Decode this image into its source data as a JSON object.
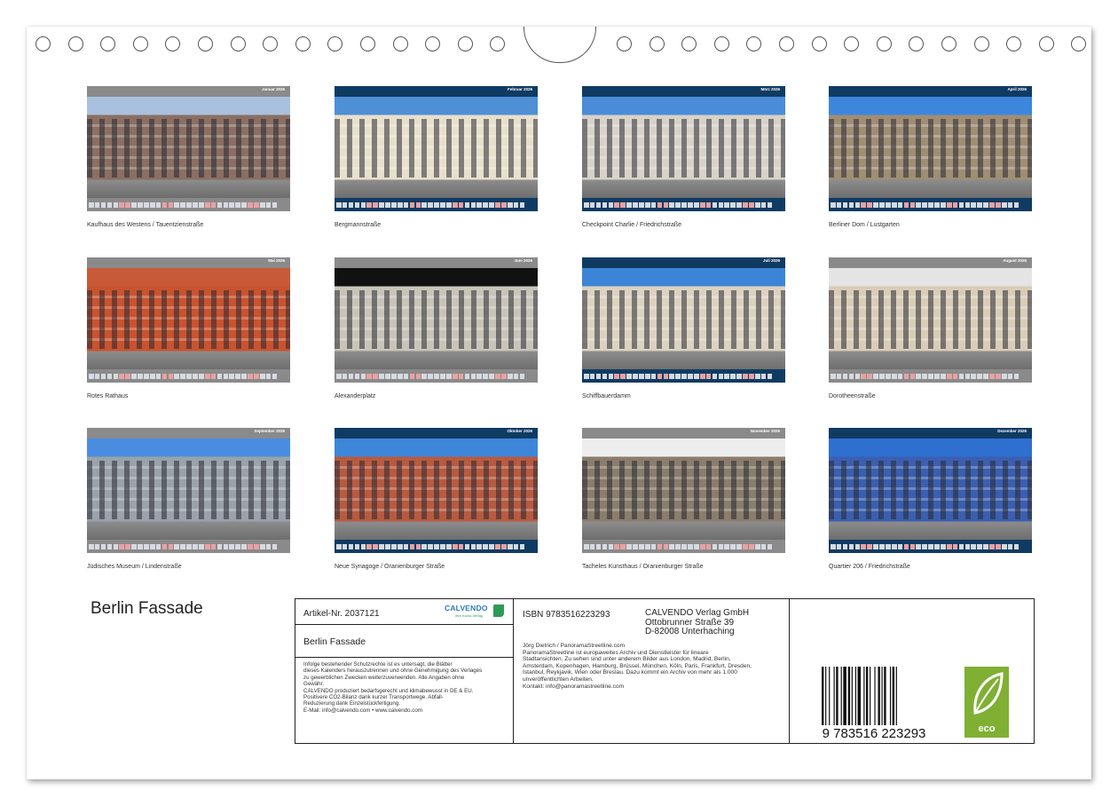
{
  "months": [
    {
      "header": "Januar 2026",
      "caption": "Kaufhaus des Westens / Tauentzienstraße",
      "header_color": "#8a8a8a",
      "sky": "#a9c1de",
      "building": "#8a6f62"
    },
    {
      "header": "Februar 2026",
      "caption": "Bergmannstraße",
      "header_color": "#0f3b63",
      "sky": "#4e8fd6",
      "building": "#e7e0cc"
    },
    {
      "header": "März 2026",
      "caption": "Checkpoint Charlie / Friedrichstraße",
      "header_color": "#0f3b63",
      "sky": "#4a8cd8",
      "building": "#d8d2c8"
    },
    {
      "header": "April 2026",
      "caption": "Berliner Dom / Lustgarten",
      "header_color": "#0f3b63",
      "sky": "#3d86dd",
      "building": "#9f8e74"
    },
    {
      "header": "Mai 2026",
      "caption": "Rotes Rathaus",
      "header_color": "#8a8a8a",
      "sky": "#c85a3a",
      "building": "#c9532f"
    },
    {
      "header": "Juni 2026",
      "caption": "Alexanderplatz",
      "header_color": "#8a8a8a",
      "sky": "#111111",
      "building": "#c9c4b8"
    },
    {
      "header": "Juli 2026",
      "caption": "Schiffbauerdamm",
      "header_color": "#0f3b63",
      "sky": "#3c84d6",
      "building": "#dcd2c0"
    },
    {
      "header": "August 2026",
      "caption": "Dorotheenstraße",
      "header_color": "#8a8a8a",
      "sky": "#e4e4e4",
      "building": "#d9cdb8"
    },
    {
      "header": "September 2026",
      "caption": "Jüdisches Museum / Lindenstraße",
      "header_color": "#8a8a8a",
      "sky": "#4a8de0",
      "building": "#9aa2ab"
    },
    {
      "header": "Oktober 2026",
      "caption": "Neue Synagoge / Oranienburger Straße",
      "header_color": "#0f3b63",
      "sky": "#3e86da",
      "building": "#b85a40"
    },
    {
      "header": "November 2026",
      "caption": "Tacheles Kunsthaus / Oranienburger Straße",
      "header_color": "#8a8a8a",
      "sky": "#eeeeee",
      "building": "#8a7d6c"
    },
    {
      "header": "Dezember 2026",
      "caption": "Quartier 206 / Friedrichstraße",
      "header_color": "#0f3b63",
      "sky": "#2f6fcf",
      "building": "#3b5fb0"
    }
  ],
  "title": "Berlin Fassade",
  "imprint": {
    "article": "Artikel-Nr. 2037121",
    "logo_text": "CALVENDO",
    "logo_sub": "Ihre Kunst-Verlag",
    "calendar_title": "Berlin Fassade",
    "legal": "Infolge bestehender Schutzrechte ist es untersagt, die Blätter\ndieses Kalenders herauszutrennen und ohne Genehmigung des Verlages\nzu gewerblichen Zwecken weiterzuverwenden. Alle Angaben ohne\nGewähr.\nCALVENDO produziert bedarfsgerecht und klimabewusst in DE & EU.\nPositivere CO2-Bilanz dank kurzer Transportwege. Abfall-\nReduzierung dank Einzelstückfertigung.\nE-Mail: info@calvendo.com • www.calvendo.com",
    "isbn": "ISBN 9783516223293",
    "publisher": "CALVENDO Verlag GmbH\nOttobrunner Straße 39\nD-82008 Unterhaching",
    "description": "Jörg Dietrich / PanoramaStreetline.com\nPanoramaStreetline ist europaweites Archiv und Dienstleister für lineare\nStadtansichten. Zu sehen sind unter anderem Bilder aus London, Madrid, Berlin,\nAmsterdam, Kopenhagen, Hamburg, Brüssel, München, Köln, Paris, Frankfurt, Dresden,\nIstanbul, Reykjavik, Wien oder Breslau. Dazu kommt ein Archiv von mehr als 1.000\nunveröffentlichten Arbeiten.\nKontakt: info@panoramastreetline.com",
    "barcode_number": "9 783516 223293",
    "eco_label": "eco"
  }
}
